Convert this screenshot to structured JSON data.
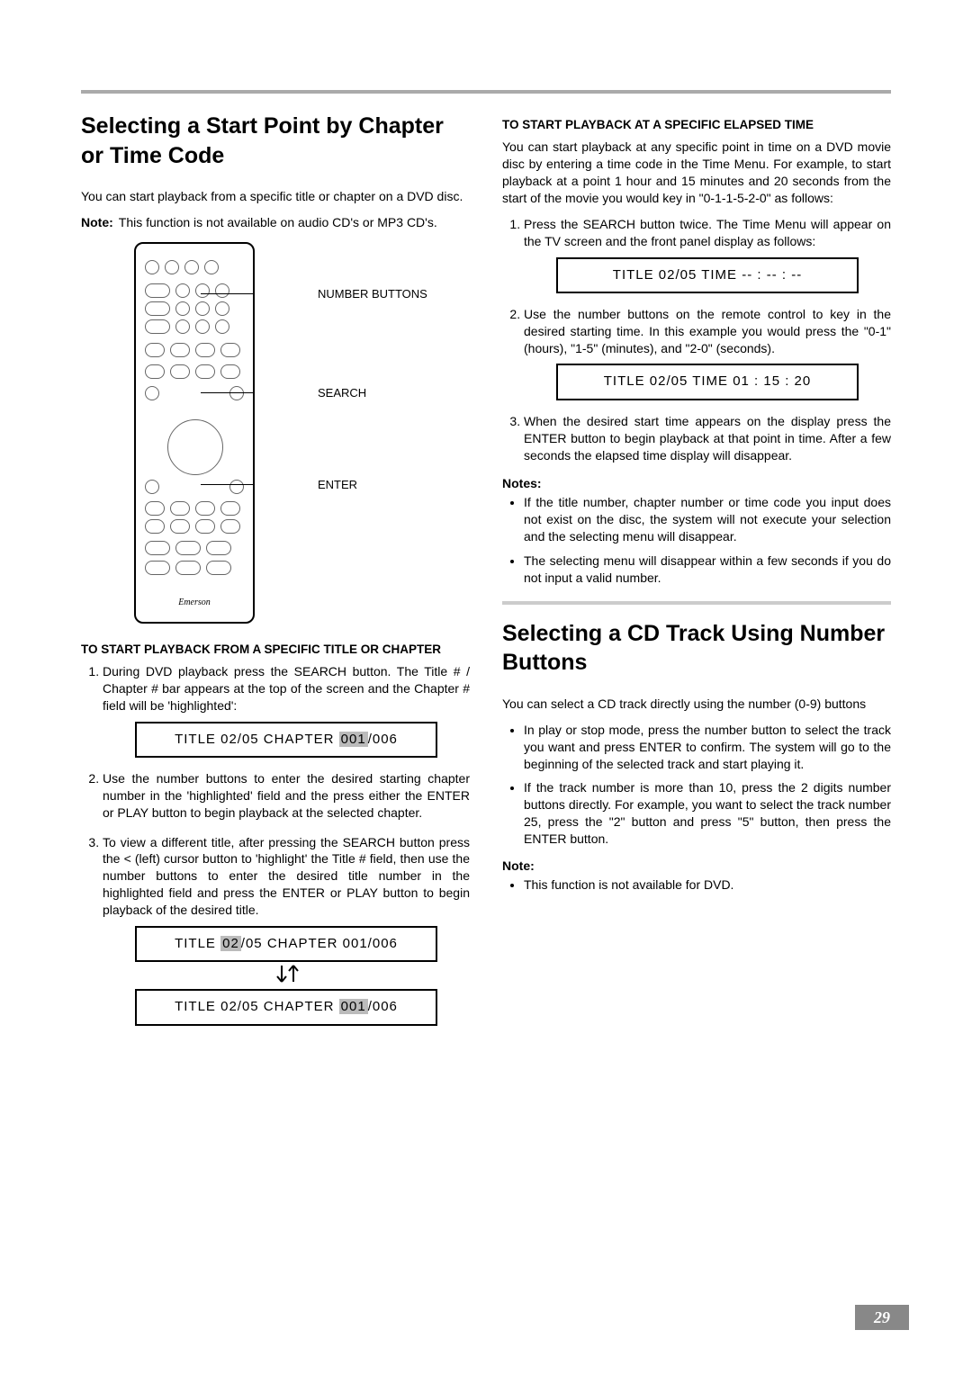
{
  "page_number": "29",
  "left": {
    "h1": "Selecting a Start Point by Chapter or Time Code",
    "intro": "You can start playback from a specific title or chapter on a DVD disc.",
    "note_label": "Note:",
    "note_text": "This function is not available on audio CD's or MP3 CD's.",
    "remote_brand": "Emerson",
    "callout_number": "NUMBER BUTTONS",
    "callout_search": "SEARCH",
    "callout_enter": "ENTER",
    "sec_a_head": "TO START PLAYBACK FROM A SPECIFIC TITLE OR CHAPTER",
    "sec_a_items": [
      "During DVD playback press the SEARCH button. The Title # / Chapter # bar appears at the top of the screen and the Chapter # field will be 'highlighted':",
      "Use the number buttons to enter the desired starting chapter number in the 'highlighted' field and the press either the ENTER or PLAY button to begin playback at the selected chapter.",
      "To view a different title, after pressing the SEARCH button press the < (left) cursor button to 'highlight' the Title # field, then use the number buttons to enter the desired title number in the highlighted field and press the ENTER or PLAY button to begin playback of the desired title."
    ],
    "display1_pre": "TITLE  02/05  CHAPTER  ",
    "display1_hi": "001",
    "display1_post": "/006",
    "display2a_pre": "TITLE ",
    "display2a_hi": "02",
    "display2a_post": "/05  CHAPTER  001/006",
    "display2b_pre": "TITLE  02/05  CHAPTER  ",
    "display2b_hi": "001",
    "display2b_post": "/006"
  },
  "right": {
    "sec_b_head": "TO START PLAYBACK AT A SPECIFIC ELAPSED TIME",
    "sec_b_intro": "You can start playback at any specific point in time on a DVD movie disc by entering a time code in the Time Menu. For example, to start playback at a point 1 hour and 15 minutes and 20 seconds from the start of the movie you would key in \"0-1-1-5-2-0\" as follows:",
    "sec_b_items": [
      "Press the SEARCH button twice. The Time Menu will appear on the TV screen and the front panel display as follows:",
      "Use the number buttons on the remote control to key in the desired starting time. In this example you would press the \"0-1\" (hours), \"1-5\" (minutes), and \"2-0\" (seconds).",
      "When the desired start time appears on the display press the ENTER button to begin playback at that point in time. After a few seconds the elapsed time display will disappear."
    ],
    "time_display_blank": "TITLE  02/05  TIME  -- : -- : --",
    "time_display_set": "TITLE  02/05  TIME  01 : 15 : 20",
    "notes_label": "Notes:",
    "notes": [
      "If the title number, chapter number or time code you input does not exist on the disc, the system will not execute your selection and the selecting menu will disappear.",
      "The selecting menu will disappear within a few seconds if you do not input a valid number."
    ],
    "h2": "Selecting a CD Track Using Number Buttons",
    "cd_intro": "You can select a CD track directly using the number (0-9) buttons",
    "cd_items": [
      "In play or stop mode, press the number button to select the track you want and press ENTER to confirm. The system will go to the beginning of the selected track and start playing it.",
      "If the track number is more than 10, press the 2 digits number buttons directly. For example, you want to select the track number 25, press the \"2\" button and press \"5\" button, then press the ENTER button."
    ],
    "note2_label": "Note:",
    "note2_item": "This function is not available for DVD."
  }
}
